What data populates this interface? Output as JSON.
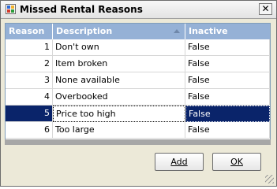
{
  "window": {
    "title": "Missed Rental Reasons",
    "close_glyph": "✕"
  },
  "grid": {
    "columns": [
      {
        "label": "Reason"
      },
      {
        "label": "Description"
      },
      {
        "label": "Inactive"
      }
    ],
    "rows": [
      {
        "reason": "1",
        "description": "Don't own",
        "inactive": "False"
      },
      {
        "reason": "2",
        "description": "Item broken",
        "inactive": "False"
      },
      {
        "reason": "3",
        "description": "None available",
        "inactive": "False"
      },
      {
        "reason": "4",
        "description": "Overbooked",
        "inactive": "False"
      },
      {
        "reason": "5",
        "description": "Price too high",
        "inactive": "False"
      },
      {
        "reason": "6",
        "description": "Too large",
        "inactive": "False"
      }
    ],
    "selected_row_index": 4,
    "sort_column": "Description",
    "header_color": "#95b1d6",
    "selection_color": "#0a246a"
  },
  "buttons": {
    "add": "Add",
    "ok": "OK"
  }
}
